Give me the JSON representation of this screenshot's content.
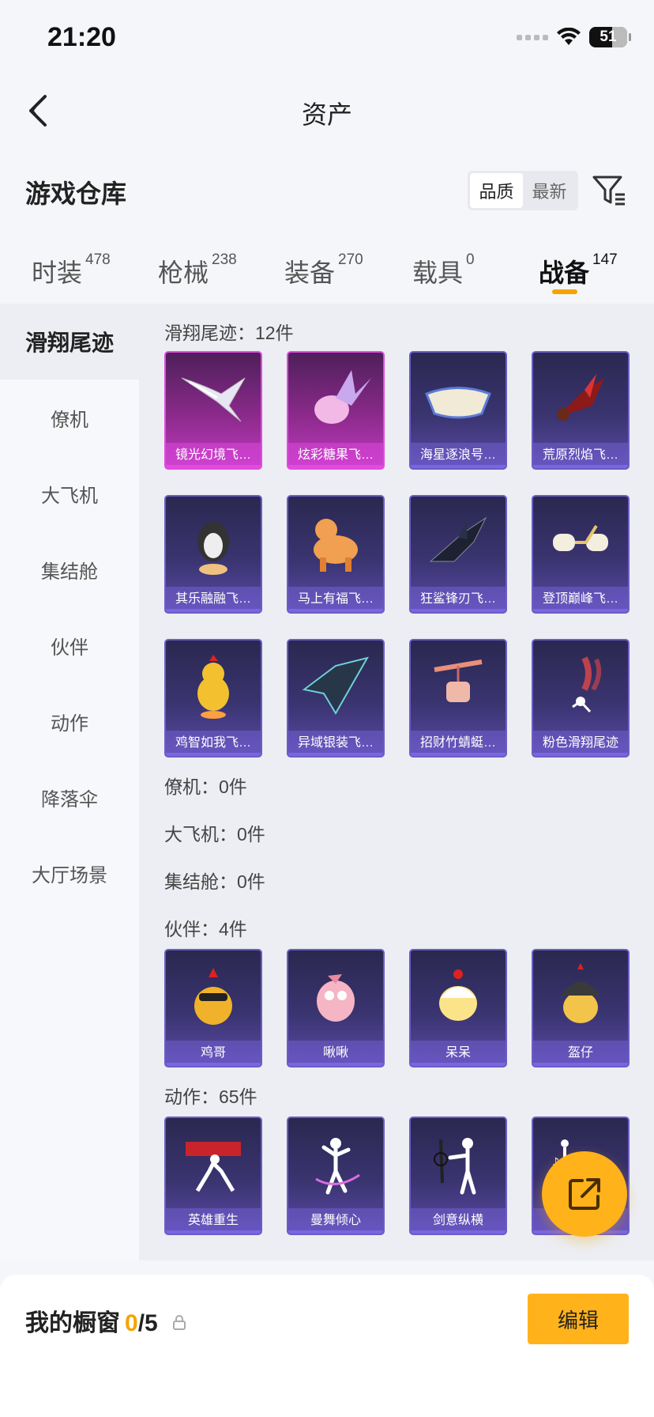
{
  "status_bar": {
    "time": "21:20",
    "battery": "51"
  },
  "nav": {
    "title": "资产"
  },
  "warehouse": {
    "title": "游戏仓库",
    "sort_options": [
      "品质",
      "最新"
    ]
  },
  "tabs": [
    {
      "label": "时装",
      "count": "478"
    },
    {
      "label": "枪械",
      "count": "238"
    },
    {
      "label": "装备",
      "count": "270"
    },
    {
      "label": "载具",
      "count": "0"
    },
    {
      "label": "战备",
      "count": "147"
    }
  ],
  "sidebar": {
    "items": [
      "滑翔尾迹",
      "僚机",
      "大飞机",
      "集结舱",
      "伙伴",
      "动作",
      "降落伞",
      "大厅场景"
    ]
  },
  "sections": {
    "glide": {
      "title": "滑翔尾迹：12件",
      "items": [
        "镜光幻境飞…",
        "炫彩糖果飞…",
        "海星逐浪号…",
        "荒原烈焰飞…",
        "其乐融融飞…",
        "马上有福飞…",
        "狂鲨锋刃飞…",
        "登顶巅峰飞…",
        "鸡智如我飞…",
        "异域银装飞…",
        "招财竹蜻蜓…",
        "粉色滑翔尾迹"
      ]
    },
    "wingman": {
      "title": "僚机：0件"
    },
    "plane": {
      "title": "大飞机：0件"
    },
    "pod": {
      "title": "集结舱：0件"
    },
    "partner": {
      "title": "伙伴：4件",
      "items": [
        "鸡哥",
        "啾啾",
        "呆呆",
        "盔仔"
      ]
    },
    "emote": {
      "title": "动作：65件",
      "items": [
        "英雄重生",
        "曼舞倾心",
        "剑意纵横",
        ""
      ]
    }
  },
  "showcase": {
    "label": "我的橱窗",
    "count": "0",
    "total": "/5",
    "edit_label": "编辑"
  },
  "colors": {
    "accent": "#ffb21a",
    "tab_underline": "#f5a300",
    "card_purple": "#5b4aa8",
    "card_pink": "#c03ac0"
  }
}
